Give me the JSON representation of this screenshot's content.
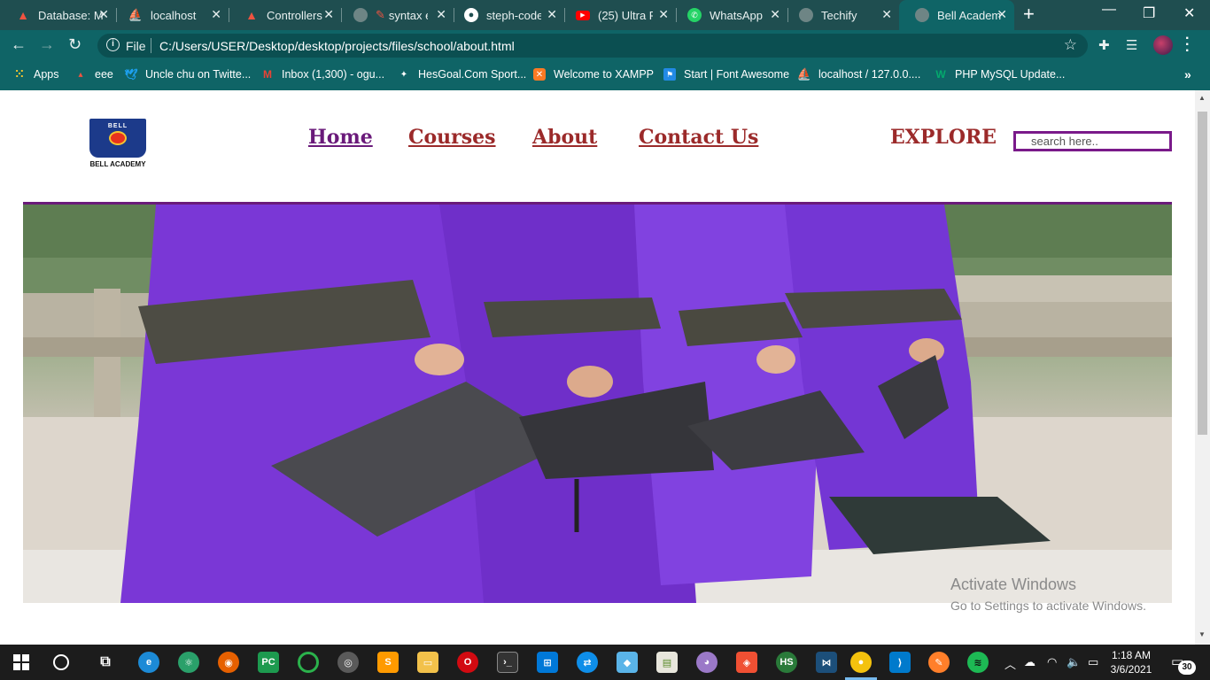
{
  "browser": {
    "tabs": [
      {
        "title": "Database: M",
        "icon": "laravel-icon",
        "color": "#f05340"
      },
      {
        "title": "localhost",
        "icon": "phpmyadmin-icon",
        "color": "#f0a030"
      },
      {
        "title": "Controllers",
        "icon": "laravel-icon",
        "color": "#f05340"
      },
      {
        "title": "syntax e",
        "icon": "globe-icon",
        "color": "#9aa"
      },
      {
        "title": "steph-code",
        "icon": "github-icon",
        "color": "#ffffff"
      },
      {
        "title": "(25) Ultra R",
        "icon": "youtube-icon",
        "color": "#ff0000"
      },
      {
        "title": "WhatsApp",
        "icon": "whatsapp-icon",
        "color": "#25d366"
      },
      {
        "title": "Techify",
        "icon": "globe-icon",
        "color": "#9aa"
      },
      {
        "title": "Bell Academ",
        "icon": "globe-icon",
        "color": "#9aa"
      }
    ],
    "new_tab_label": "+",
    "address": {
      "scheme": "File",
      "url": "C:/Users/USER/Desktop/desktop/projects/files/school/about.html"
    },
    "bookmarks": [
      {
        "label": "Apps",
        "icon": "apps-grid-icon"
      },
      {
        "label": "eee",
        "icon": "bookmark-icon"
      },
      {
        "label": "Uncle chu on Twitte...",
        "icon": "twitter-icon"
      },
      {
        "label": "Inbox (1,300) - ogu...",
        "icon": "gmail-icon"
      },
      {
        "label": "HesGoal.Com Sport...",
        "icon": "soccer-icon"
      },
      {
        "label": "Welcome to XAMPP",
        "icon": "xampp-icon"
      },
      {
        "label": "Start | Font Awesome",
        "icon": "flag-icon"
      },
      {
        "label": "localhost / 127.0.0....",
        "icon": "phpmyadmin-icon"
      },
      {
        "label": "PHP MySQL Update...",
        "icon": "w3-icon"
      }
    ]
  },
  "page": {
    "logo": {
      "top_text": "BELL",
      "name": "BELL ACADEMY"
    },
    "nav": [
      "Home",
      "Courses",
      "About",
      "Contact Us"
    ],
    "explore_label": "EXPLORE",
    "search_placeholder": "search here..",
    "hero_alt": "Graduates in purple gowns holding caps",
    "watermark": {
      "title": "Activate Windows",
      "subtitle": "Go to Settings to activate Windows."
    }
  },
  "taskbar": {
    "time": "1:18 AM",
    "date": "3/6/2021",
    "notifications": "30"
  }
}
